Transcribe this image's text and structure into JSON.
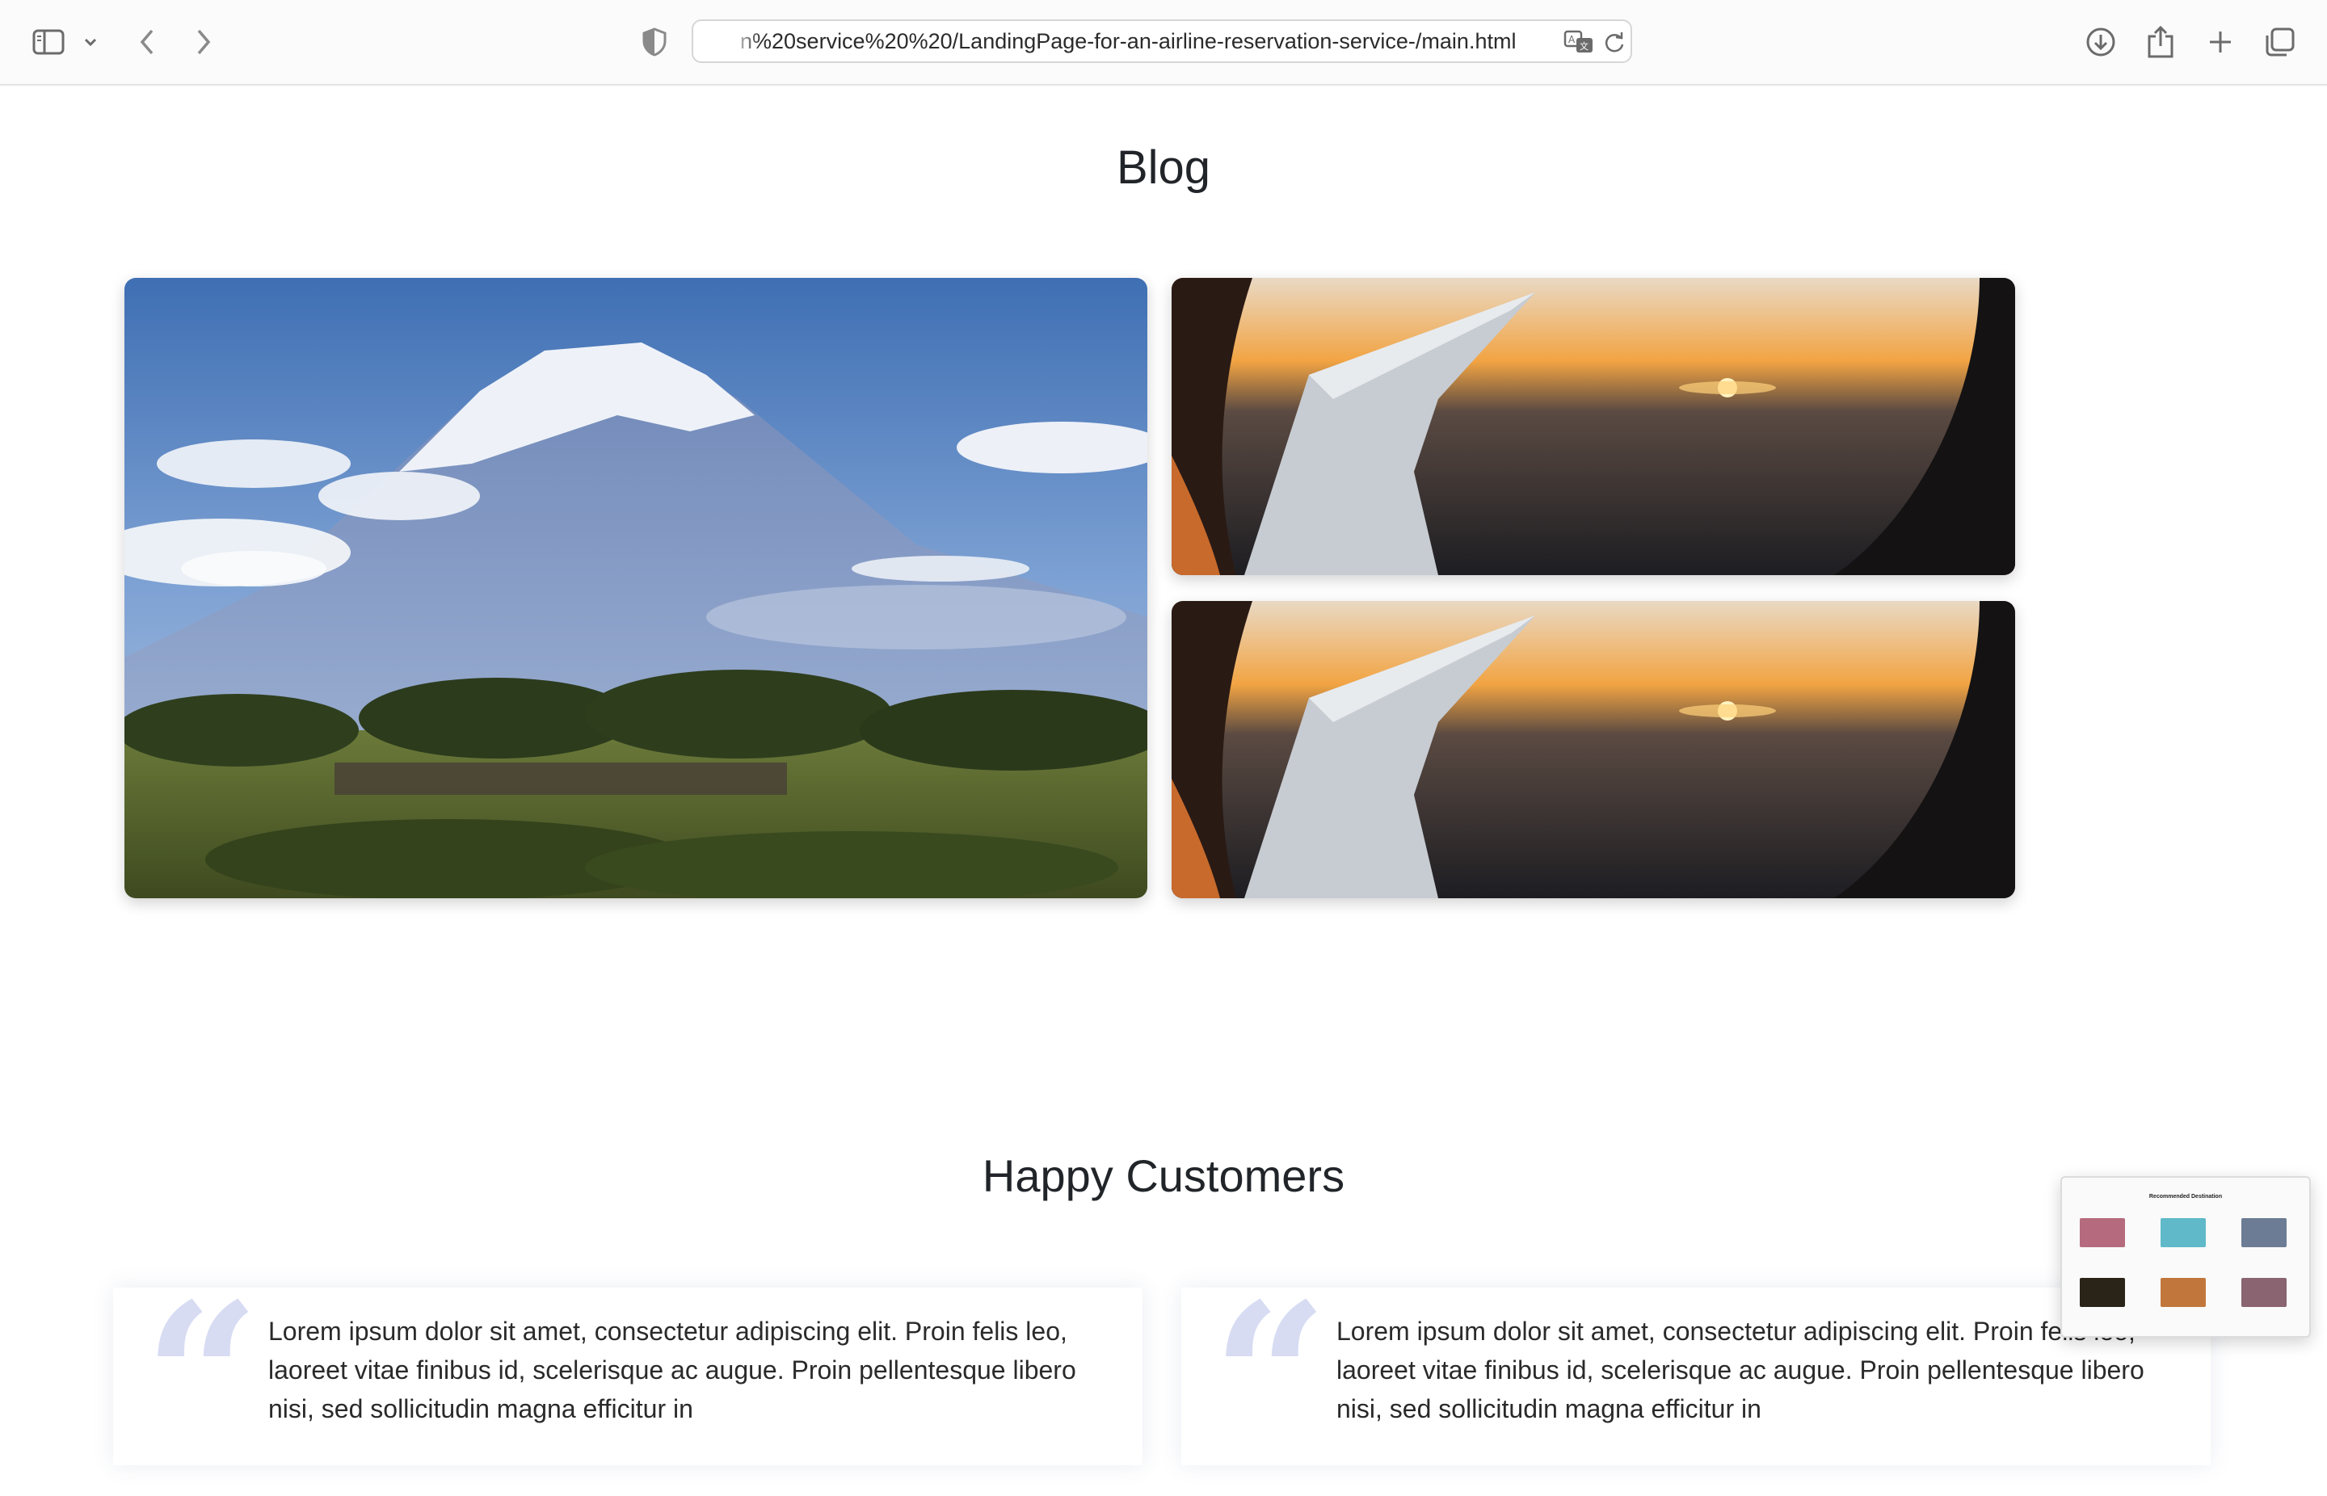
{
  "browser": {
    "url": "n%20service%20%20/LandingPage-for-an-airline-reservation-service-/main.html",
    "icons": [
      "sidebar-icon",
      "chevron-down-icon",
      "back-arrow-icon",
      "forward-arrow-icon",
      "shield-icon",
      "translate-icon",
      "reload-icon",
      "download-icon",
      "share-icon",
      "new-tab-icon",
      "tabs-overview-icon"
    ]
  },
  "blog": {
    "title": "Blog",
    "images": [
      {
        "alt": "Mount Kilimanjaro with elephants on the savanna"
      },
      {
        "alt": "Airplane wing at sunset seen through window"
      },
      {
        "alt": "Airplane wing at sunset seen through window"
      }
    ]
  },
  "customers": {
    "title": "Happy Customers",
    "quote_mark": "“",
    "testimonials": [
      {
        "text": "Lorem ipsum dolor sit amet, consectetur adipiscing elit. Proin felis leo, laoreet vitae finibus id, scelerisque ac augue. Proin pellentesque libero nisi, sed sollicitudin magna efficitur in"
      },
      {
        "text": "Lorem ipsum dolor sit amet, consectetur adipiscing elit. Proin felis leo, laoreet vitae finibus id, scelerisque ac augue. Proin pellentesque libero nisi, sed sollicitudin magna efficitur in"
      }
    ]
  },
  "thumbnail": {
    "title": "Recommended Destination"
  },
  "colors": {
    "quote": "#d7dcf3",
    "sky": "#5b86c4",
    "sunset": "#f2a443"
  }
}
